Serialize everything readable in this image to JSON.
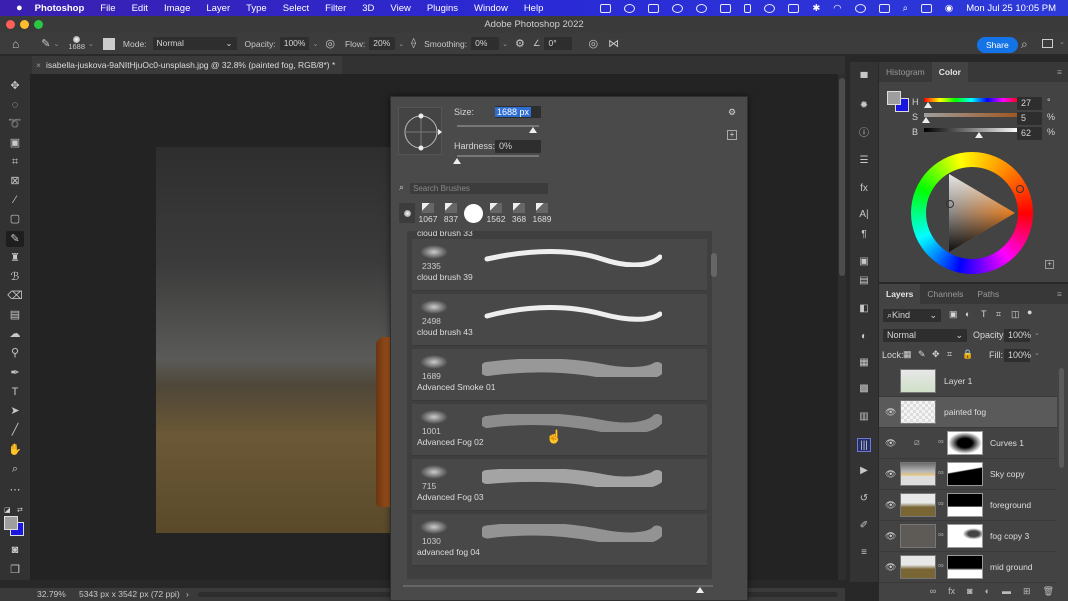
{
  "menubar": {
    "apple": "",
    "items": [
      "Photoshop",
      "File",
      "Edit",
      "Image",
      "Layer",
      "Type",
      "Select",
      "Filter",
      "3D",
      "View",
      "Plugins",
      "Window",
      "Help"
    ],
    "clock": "Mon Jul 25  10:05 PM"
  },
  "window": {
    "title": "Adobe Photoshop 2022"
  },
  "options": {
    "brush_size": "1688",
    "mode_label": "Mode:",
    "mode_value": "Normal",
    "opacity_label": "Opacity:",
    "opacity_value": "100%",
    "flow_label": "Flow:",
    "flow_value": "20%",
    "smoothing_label": "Smoothing:",
    "smoothing_value": "0%",
    "angle_value": "0°",
    "share_label": "Share"
  },
  "document": {
    "tab_title": "isabella-juskova-9aNItHjuOc0-unsplash.jpg @ 32.8% (painted fog, RGB/8*) *",
    "zoom": "32.79%",
    "dimensions": "5343 px x 3542 px (72 ppi)"
  },
  "brush_popup": {
    "size_label": "Size:",
    "size_value": "1688 px",
    "size_fraction": 0.92,
    "hardness_label": "Hardness:",
    "hardness_value": "0%",
    "hardness_fraction": 0.0,
    "search_placeholder": "Search Brushes",
    "presets": [
      "1067",
      "837",
      "",
      "1562",
      "368",
      "1689"
    ],
    "partial_top": "cloud brush 33",
    "brushes": [
      {
        "size": "2335",
        "name": "cloud brush 39"
      },
      {
        "size": "2498",
        "name": "cloud brush 43"
      },
      {
        "size": "1689",
        "name": "Advanced Smoke 01"
      },
      {
        "size": "1001",
        "name": "Advanced Fog 02"
      },
      {
        "size": "715",
        "name": "Advanced Fog 03"
      },
      {
        "size": "1030",
        "name": "advanced fog 04"
      }
    ]
  },
  "color_panel": {
    "tabs": [
      "Histogram",
      "Color"
    ],
    "active_tab": "Color",
    "h_label": "H",
    "h_value": "27",
    "h_unit": "°",
    "s_label": "S",
    "s_value": "5",
    "s_unit": "%",
    "b_label": "B",
    "b_value": "62",
    "b_unit": "%",
    "foreground": "#9e9e9e",
    "background": "#1a16e0"
  },
  "layers_panel": {
    "tabs": [
      "Layers",
      "Channels",
      "Paths"
    ],
    "active_tab": "Layers",
    "filter_kind": "Kind",
    "blend_mode": "Normal",
    "opacity_label": "Opacity:",
    "opacity_value": "100%",
    "lock_label": "Lock:",
    "fill_label": "Fill:",
    "fill_value": "100%",
    "layers": [
      {
        "name": "Layer 1",
        "visible": false
      },
      {
        "name": "painted fog",
        "visible": true,
        "selected": true
      },
      {
        "name": "Curves 1",
        "visible": true
      },
      {
        "name": "Sky copy",
        "visible": true
      },
      {
        "name": "foreground",
        "visible": true
      },
      {
        "name": "fog copy 3",
        "visible": true
      },
      {
        "name": "mid ground",
        "visible": true
      }
    ]
  }
}
